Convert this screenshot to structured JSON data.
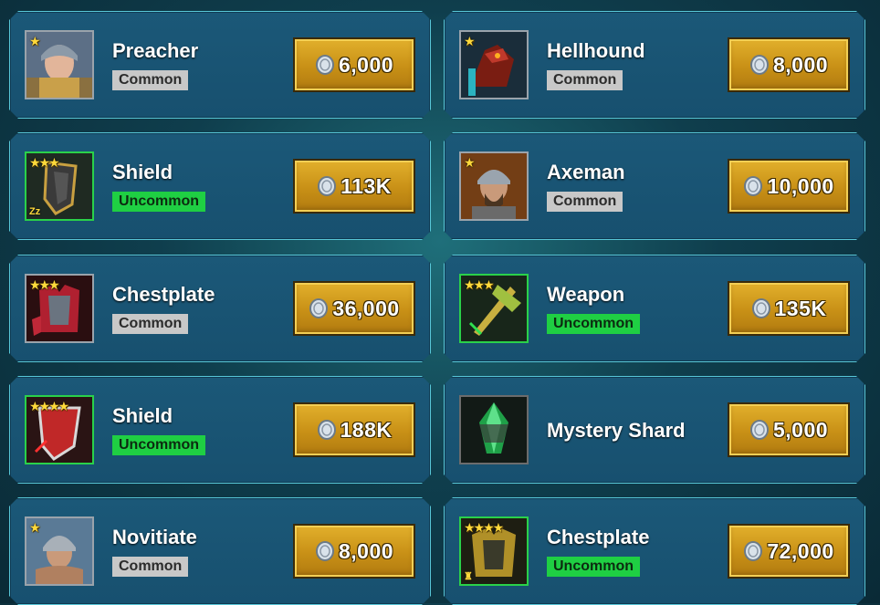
{
  "colors": {
    "common": "#c8c8c8",
    "uncommon": "#1fcf43",
    "price_gold": "#d2a01e",
    "card_border": "#58c7d8"
  },
  "items": [
    {
      "name": "Preacher",
      "rarity": "Common",
      "price": "6,000",
      "stars": "★",
      "icon": "preacher-portrait-icon"
    },
    {
      "name": "Hellhound",
      "rarity": "Common",
      "price": "8,000",
      "stars": "★",
      "icon": "hellhound-portrait-icon"
    },
    {
      "name": "Shield",
      "rarity": "Uncommon",
      "price": "113K",
      "stars": "★★★",
      "icon": "shield-artifact-icon"
    },
    {
      "name": "Axeman",
      "rarity": "Common",
      "price": "10,000",
      "stars": "★",
      "icon": "axeman-portrait-icon"
    },
    {
      "name": "Chestplate",
      "rarity": "Common",
      "price": "36,000",
      "stars": "★★★",
      "icon": "chestplate-artifact-icon"
    },
    {
      "name": "Weapon",
      "rarity": "Uncommon",
      "price": "135K",
      "stars": "★★★",
      "icon": "weapon-artifact-icon"
    },
    {
      "name": "Shield",
      "rarity": "Uncommon",
      "price": "188K",
      "stars": "★★★★",
      "icon": "shield-artifact-icon"
    },
    {
      "name": "Mystery Shard",
      "rarity": "",
      "price": "5,000",
      "stars": "",
      "icon": "mystery-shard-icon"
    },
    {
      "name": "Novitiate",
      "rarity": "Common",
      "price": "8,000",
      "stars": "★",
      "icon": "novitiate-portrait-icon"
    },
    {
      "name": "Chestplate",
      "rarity": "Uncommon",
      "price": "72,000",
      "stars": "★★★★",
      "icon": "chestplate-artifact-icon"
    }
  ]
}
